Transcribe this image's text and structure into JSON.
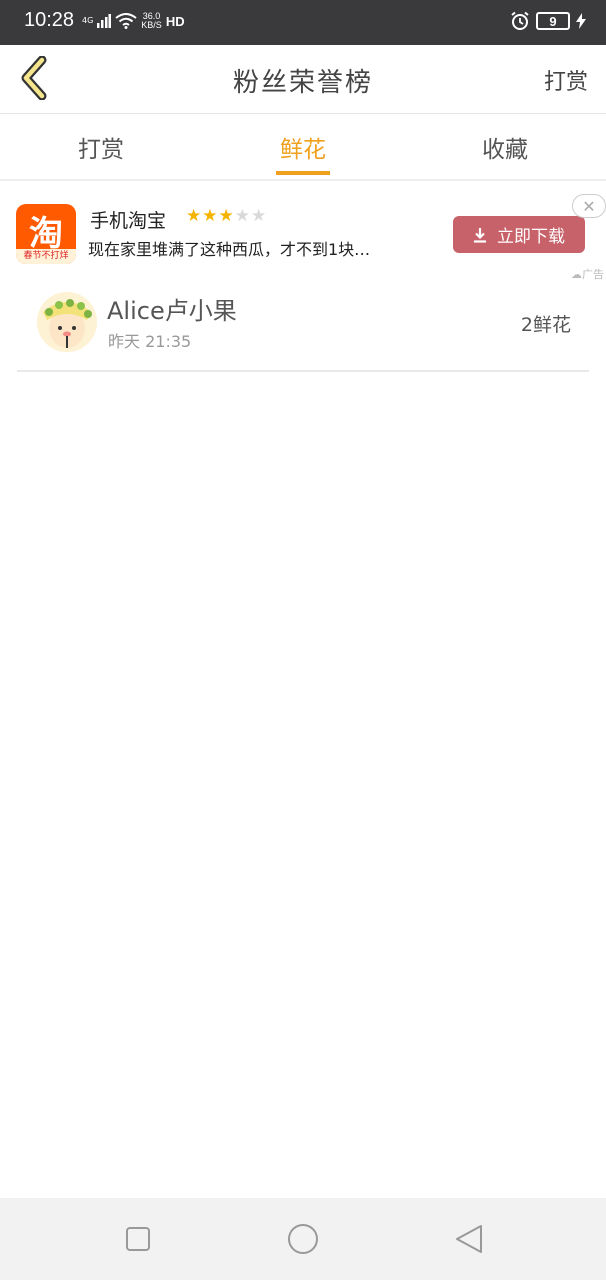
{
  "status_bar": {
    "time": "10:28",
    "network": "4G",
    "speed_value": "36.0",
    "speed_unit": "KB/S",
    "hd": "HD",
    "battery": "9"
  },
  "header": {
    "title": "粉丝荣誉榜",
    "right_action": "打赏",
    "back_icon": "chevron-left-icon",
    "accent_color": "#f0a01c"
  },
  "tabs": [
    {
      "label": "打赏",
      "active": false
    },
    {
      "label": "鲜花",
      "active": true
    },
    {
      "label": "收藏",
      "active": false
    }
  ],
  "ad": {
    "app_icon_char": "淘",
    "app_icon_sub": "春节不打烊",
    "app_name": "手机淘宝",
    "rating": 3,
    "rating_max": 5,
    "description": "现在家里堆满了这种西瓜，才不到1块…",
    "download_label": "立即下载",
    "ad_tag": "广告",
    "button_color": "#c8626a"
  },
  "list": [
    {
      "name": "Alice卢小果",
      "time": "昨天 21:35",
      "count": "2鲜花"
    }
  ],
  "nav": {
    "items": [
      "square-icon",
      "circle-icon",
      "triangle-back-icon"
    ]
  }
}
